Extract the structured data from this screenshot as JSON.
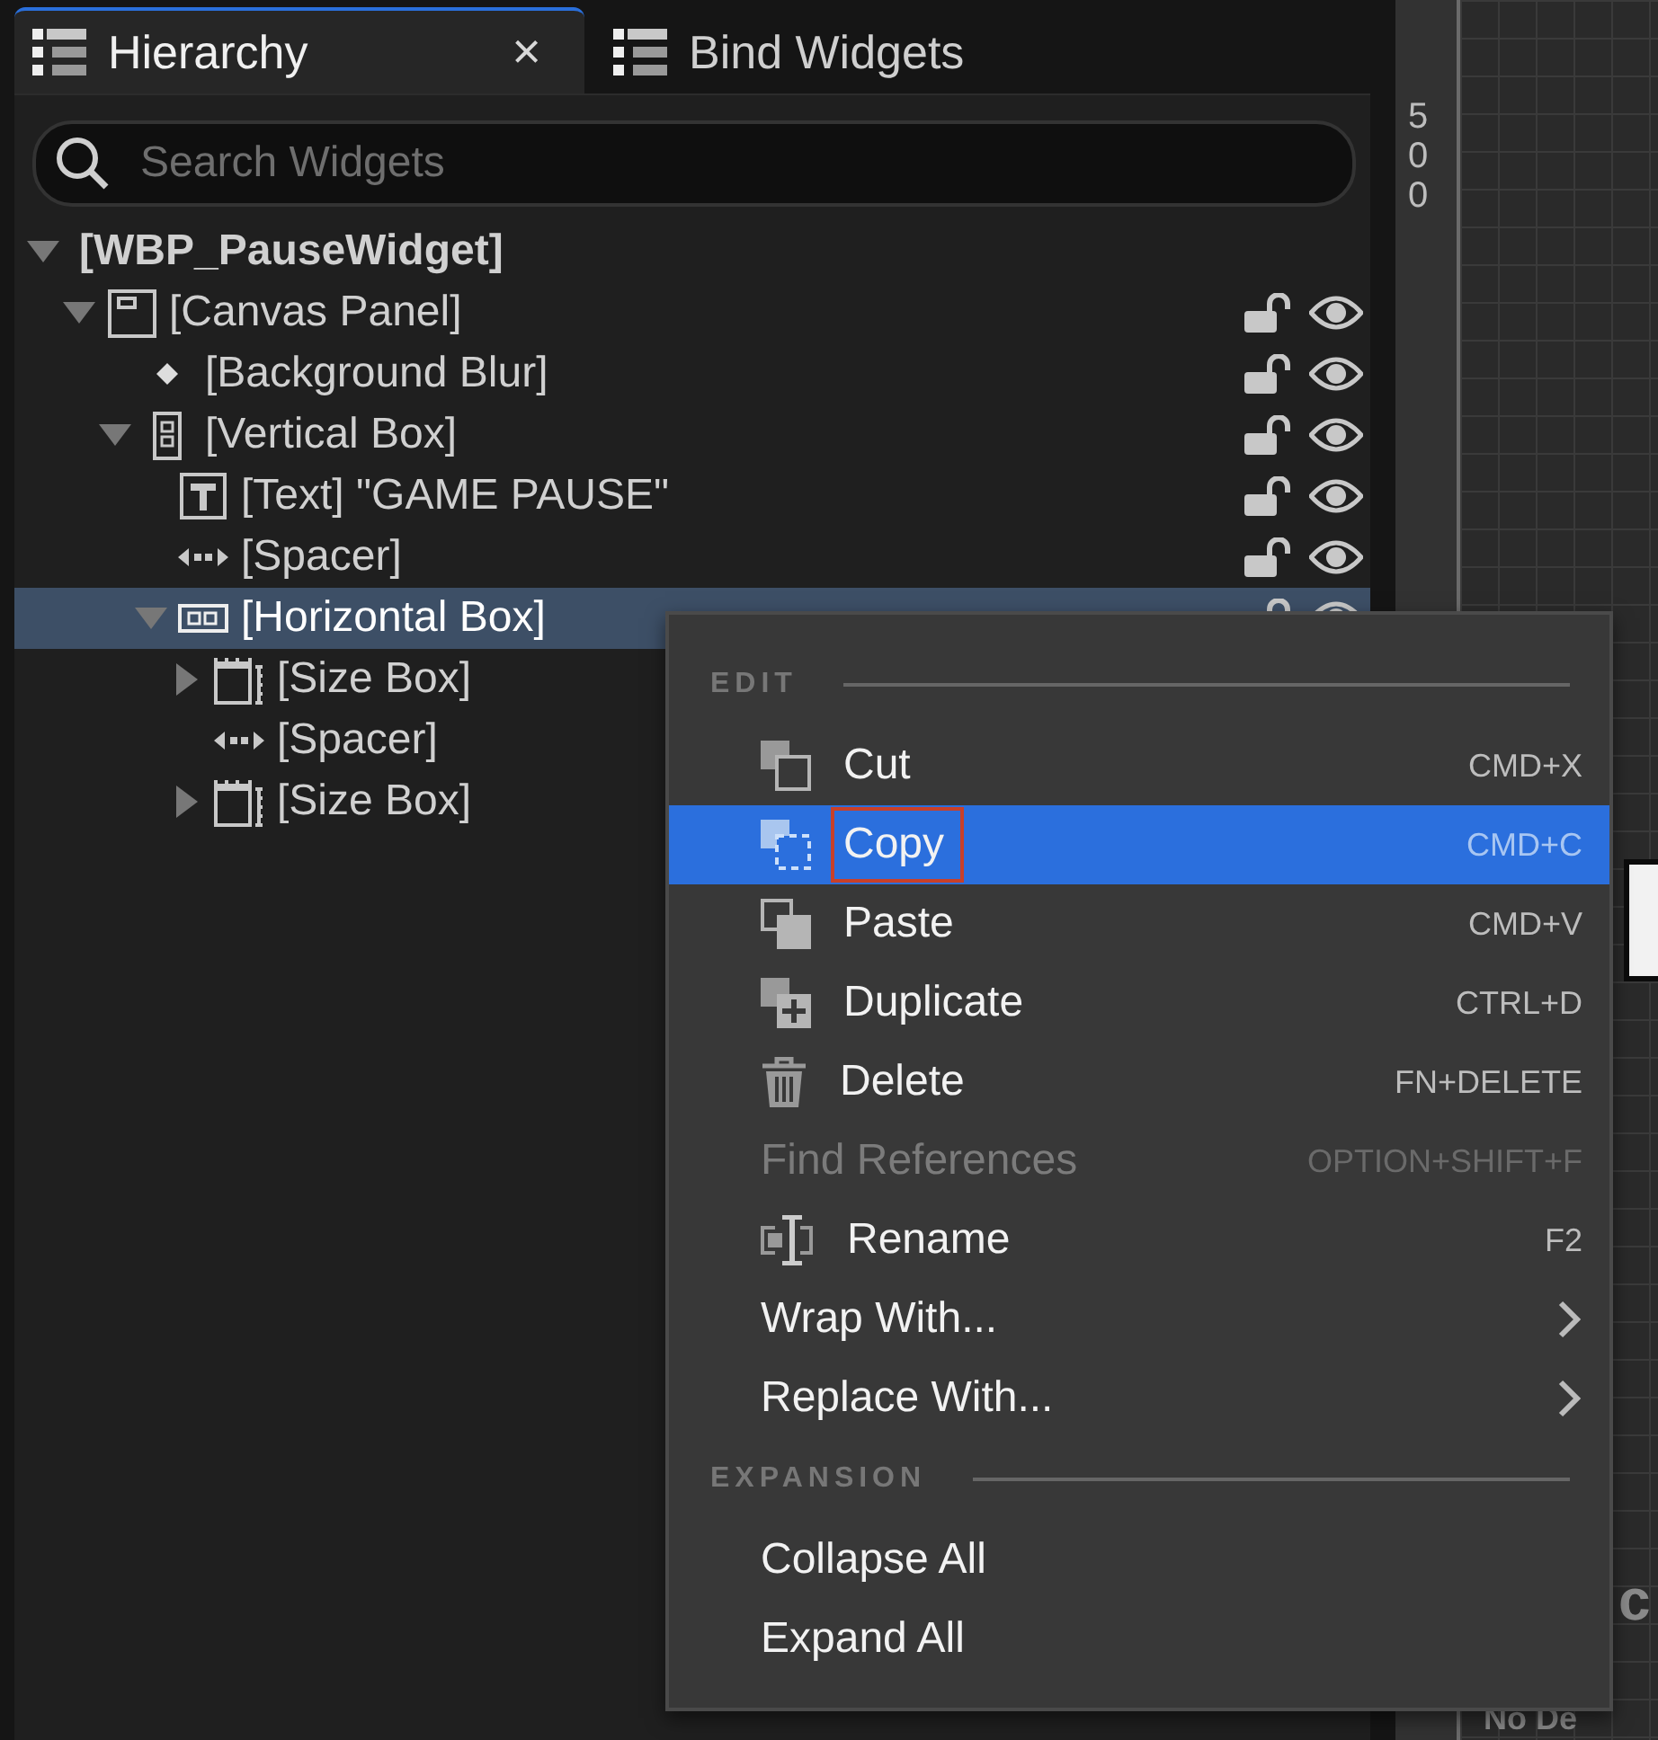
{
  "tabs": [
    {
      "label": "Hierarchy",
      "selected": true,
      "close": "×"
    },
    {
      "label": "Bind Widgets",
      "selected": false
    }
  ],
  "search": {
    "placeholder": "Search Widgets"
  },
  "tree": {
    "label": "[WBP_PauseWidget]",
    "expanded": true,
    "selected": false,
    "children": [
      {
        "label": "[Canvas Panel]",
        "kind": "canvas",
        "expanded": true,
        "selected": false,
        "locked": false,
        "visible": true,
        "children": [
          {
            "label": "[Background Blur]",
            "kind": "blur",
            "selected": false,
            "locked": false,
            "visible": true
          },
          {
            "label": "[Vertical Box]",
            "kind": "vertical",
            "expanded": true,
            "selected": false,
            "locked": false,
            "visible": true,
            "children": [
              {
                "label": "[Text] \"GAME PAUSE\"",
                "kind": "text",
                "selected": false,
                "locked": false,
                "visible": true
              },
              {
                "label": "[Spacer]",
                "kind": "spacer",
                "selected": false,
                "locked": false,
                "visible": true
              },
              {
                "label": "[Horizontal Box]",
                "kind": "horizontal",
                "expanded": true,
                "selected": true,
                "locked": false,
                "visible": true,
                "children": [
                  {
                    "label": "[Size Box]",
                    "kind": "sizebox",
                    "expanded": false,
                    "selected": false
                  },
                  {
                    "label": "[Spacer]",
                    "kind": "spacer",
                    "selected": false
                  },
                  {
                    "label": "[Size Box]",
                    "kind": "sizebox",
                    "expanded": false,
                    "selected": false
                  }
                ]
              }
            ]
          }
        ]
      }
    ]
  },
  "ruler": {
    "label": "500"
  },
  "canvas_texts": [
    {
      "text": "c"
    },
    {
      "text": "No De"
    }
  ],
  "menu": {
    "sections": [
      {
        "heading": "EDIT",
        "items": [
          {
            "label": "Cut",
            "kind": "cut",
            "shortcut": "CMD+X",
            "selected": false,
            "disabled": false
          },
          {
            "label": "Copy",
            "kind": "copy",
            "shortcut": "CMD+C",
            "selected": true,
            "disabled": false,
            "highlighted": true
          },
          {
            "label": "Paste",
            "kind": "paste",
            "shortcut": "CMD+V",
            "selected": false,
            "disabled": false
          },
          {
            "label": "Duplicate",
            "kind": "duplicate",
            "shortcut": "CTRL+D",
            "selected": false,
            "disabled": false
          },
          {
            "label": "Delete",
            "kind": "delete",
            "shortcut": "FN+DELETE",
            "selected": false,
            "disabled": false
          },
          {
            "label": "Find References",
            "kind": "plain",
            "shortcut": "OPTION+SHIFT+F",
            "selected": false,
            "disabled": true
          },
          {
            "label": "Rename",
            "kind": "rename",
            "shortcut": "F2",
            "selected": false,
            "disabled": false
          },
          {
            "label": "Wrap With...",
            "kind": "submenu",
            "selected": false,
            "disabled": false
          },
          {
            "label": "Replace With...",
            "kind": "submenu",
            "selected": false,
            "disabled": false
          }
        ]
      },
      {
        "heading": "EXPANSION",
        "items": [
          {
            "label": "Collapse All",
            "kind": "plain",
            "selected": false,
            "disabled": false
          },
          {
            "label": "Expand All",
            "kind": "plain",
            "selected": false,
            "disabled": false
          }
        ]
      }
    ]
  }
}
